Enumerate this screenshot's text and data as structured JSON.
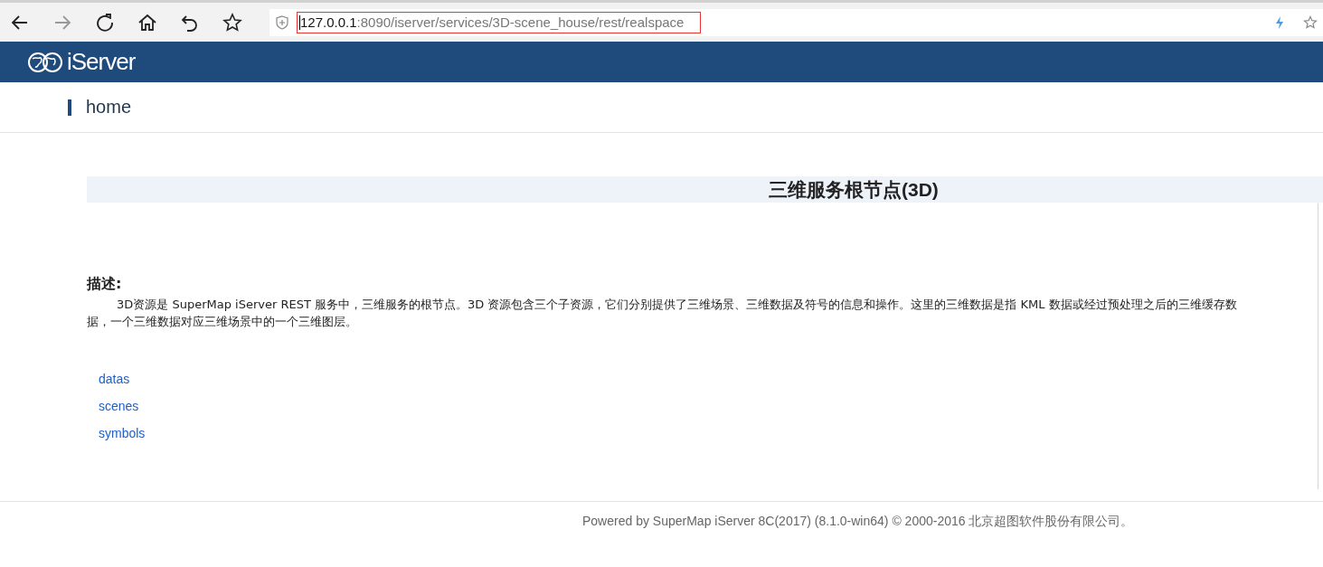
{
  "browser": {
    "url_host": "127.0.0.1",
    "url_path": ":8090/iserver/services/3D-scene_house/rest/realspace",
    "url_highlighted": true
  },
  "header": {
    "logo_text": "iServer"
  },
  "breadcrumb": {
    "label": "home"
  },
  "title": "三维服务根节点(3D)",
  "description": {
    "heading": "描述:",
    "text": "3D资源是 SuperMap iServer REST 服务中，三维服务的根节点。3D 资源包含三个子资源，它们分别提供了三维场景、三维数据及符号的信息和操作。这里的三维数据是指 KML 数据或经过预处理之后的三维缓存数据，一个三维数据对应三维场景中的一个三维图层。"
  },
  "links": [
    "datas",
    "scenes",
    "symbols"
  ],
  "footer": "Powered by SuperMap iServer 8C(2017) (8.1.0-win64) © 2000-2016 北京超图软件股份有限公司。"
}
